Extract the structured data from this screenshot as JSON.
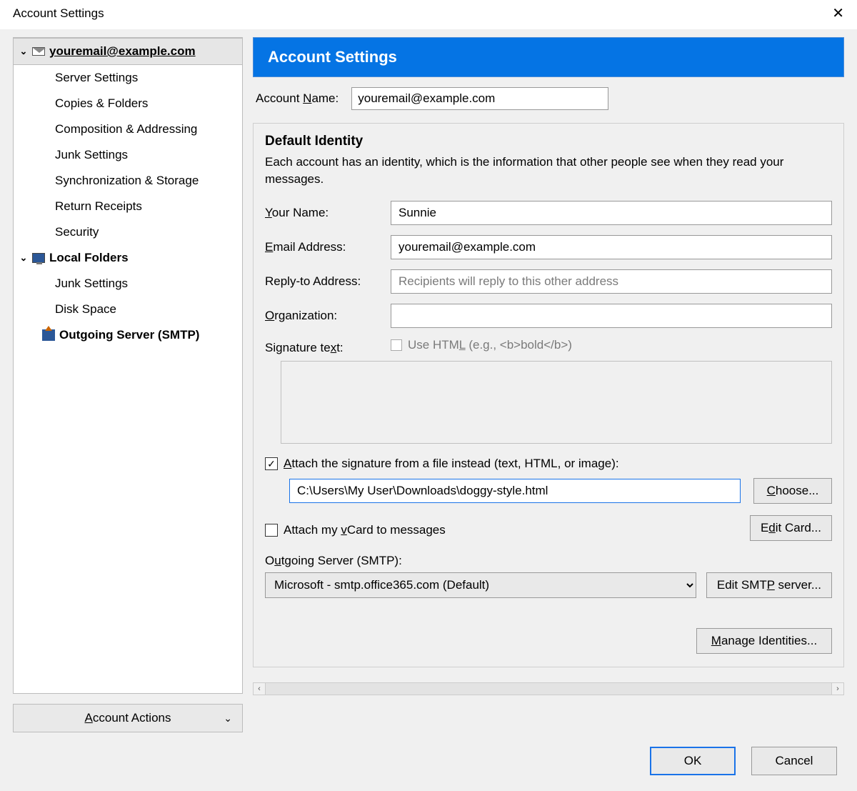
{
  "window": {
    "title": "Account Settings"
  },
  "sidebar": {
    "account_label": "youremail@example.com",
    "items": [
      "Server Settings",
      "Copies & Folders",
      "Composition & Addressing",
      "Junk Settings",
      "Synchronization & Storage",
      "Return Receipts",
      "Security"
    ],
    "local_folders_label": "Local Folders",
    "local_items": [
      "Junk Settings",
      "Disk Space"
    ],
    "smtp_label": "Outgoing Server (SMTP)",
    "actions_label": "Account Actions"
  },
  "main": {
    "header": "Account Settings",
    "account_name_label": "Account Name:",
    "account_name_value": "youremail@example.com",
    "identity": {
      "title": "Default Identity",
      "desc": "Each account has an identity, which is the information that other people see when they read your messages.",
      "your_name_label": "Your Name:",
      "your_name_value": "Sunnie",
      "email_label": "Email Address:",
      "email_value": "youremail@example.com",
      "reply_label": "Reply-to Address:",
      "reply_placeholder": "Recipients will reply to this other address",
      "org_label": "Organization:",
      "org_value": "",
      "sig_label": "Signature text:",
      "sig_html_label": "Use HTML (e.g., <b>bold</b>)",
      "attach_file_label": "Attach the signature from a file instead (text, HTML, or image):",
      "attach_file_checked": true,
      "file_path": "C:\\Users\\My User\\Downloads\\doggy-style.html",
      "choose_btn": "Choose...",
      "vcard_label": "Attach my vCard to messages",
      "vcard_checked": false,
      "edit_card_btn": "Edit Card...",
      "outgoing_label": "Outgoing Server (SMTP):",
      "outgoing_value": "Microsoft - smtp.office365.com (Default)",
      "edit_smtp_btn": "Edit SMTP server...",
      "manage_btn": "Manage Identities..."
    }
  },
  "footer": {
    "ok": "OK",
    "cancel": "Cancel"
  }
}
